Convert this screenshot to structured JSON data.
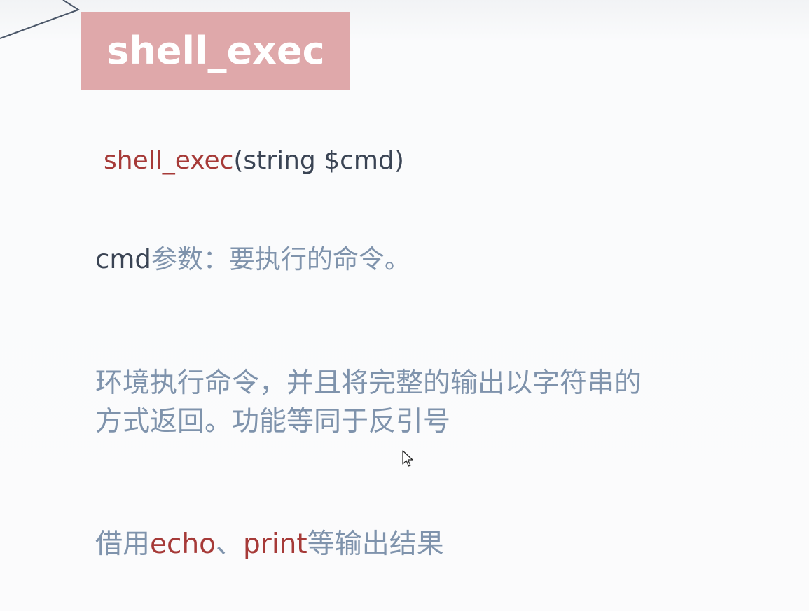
{
  "slide": {
    "title": "shell_exec",
    "signature": {
      "func": "shell_exec",
      "args": "(string $cmd)"
    },
    "param": {
      "name": "cmd",
      "desc": "参数：要执行的命令。"
    },
    "description": {
      "line1": "环境执行命令，并且将完整的输出以字符串的",
      "line2": "方式返回。功能等同于反引号"
    },
    "usage": {
      "prefix": "借用",
      "kw1": "echo",
      "sep": "、",
      "kw2": "print",
      "suffix": "等输出结果"
    }
  },
  "icons": {
    "cursor": "mouse-pointer-icon",
    "decor": "corner-outline-shape"
  },
  "colors": {
    "title_bg": "#dfa8aa",
    "title_fg": "#ffffff",
    "keyword_red": "#a63a38",
    "dark_text": "#3a4454",
    "slate_text": "#7f93ac",
    "background": "#fbfbfc"
  }
}
